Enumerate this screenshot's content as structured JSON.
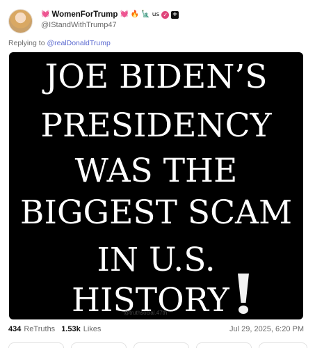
{
  "post": {
    "display_name": "WomenForTrump",
    "name_emojis": [
      "💓",
      "🔥",
      "🗽",
      "us"
    ],
    "handle": "@IStandWithTrump47",
    "replying_prefix": "Replying to",
    "replying_to": "@realDonaldTrump",
    "image_text": {
      "line1": "JOE BIDEN’S",
      "line2": "PRESIDENCY",
      "line3": "WAS THE",
      "line4": "BIGGEST SCAM",
      "line5": "IN U.S.",
      "line6": "HISTORY",
      "watermark": "@truthsocial.47th"
    },
    "stats": {
      "retruths_count": "434",
      "retruths_label": "ReTruths",
      "likes_count": "1.53k",
      "likes_label": "Likes",
      "timestamp": "Jul 29, 2025, 6:20 PM"
    }
  },
  "icons": {
    "verified": "verified-badge-icon",
    "plus": "plus-badge-icon"
  }
}
